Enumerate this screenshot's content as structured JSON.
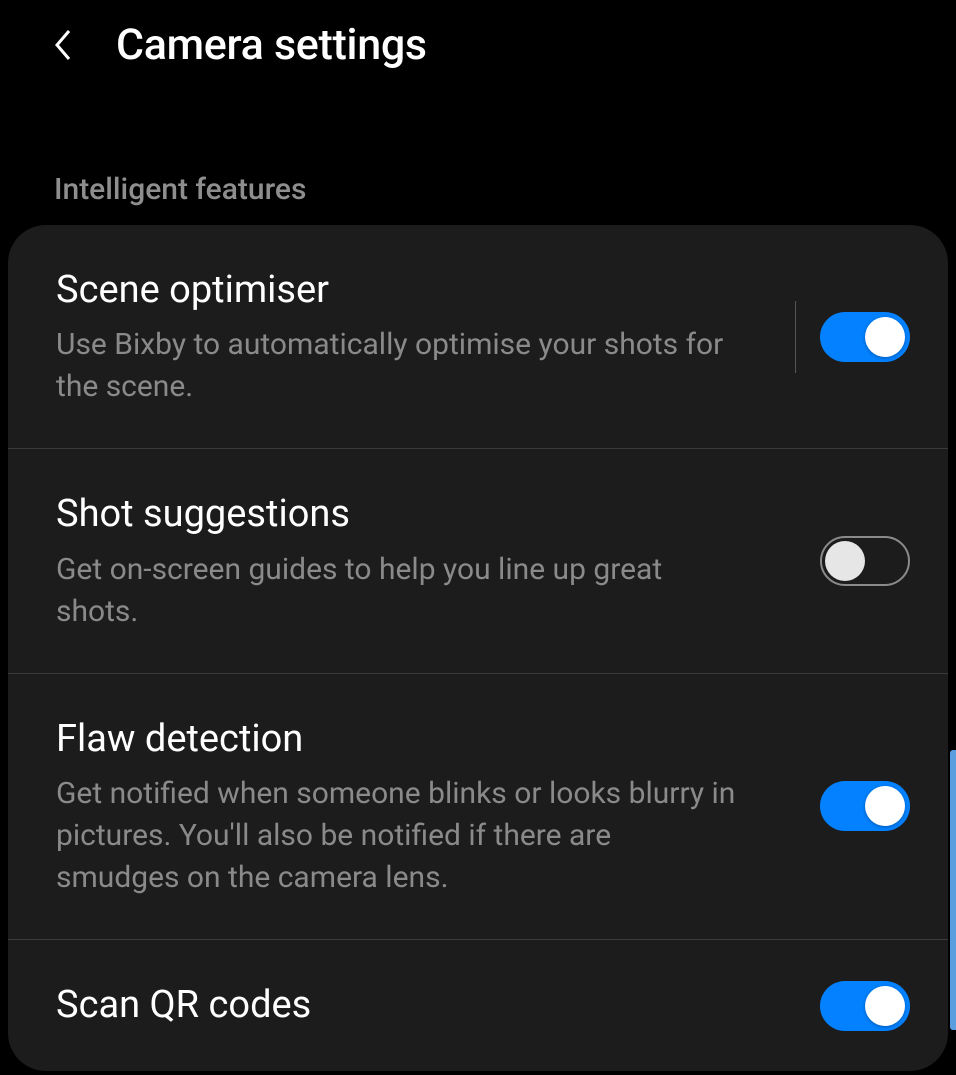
{
  "header": {
    "title": "Camera settings"
  },
  "section": {
    "label": "Intelligent features"
  },
  "settings": {
    "scene_optimiser": {
      "title": "Scene optimiser",
      "description": "Use Bixby to automatically optimise your shots for the scene.",
      "enabled": true
    },
    "shot_suggestions": {
      "title": "Shot suggestions",
      "description": "Get on-screen guides to help you line up great shots.",
      "enabled": false
    },
    "flaw_detection": {
      "title": "Flaw detection",
      "description": "Get notified when someone blinks or looks blurry in pictures. You'll also be notified if there are smudges on the camera lens.",
      "enabled": true
    },
    "scan_qr": {
      "title": "Scan QR codes",
      "enabled": true
    }
  }
}
